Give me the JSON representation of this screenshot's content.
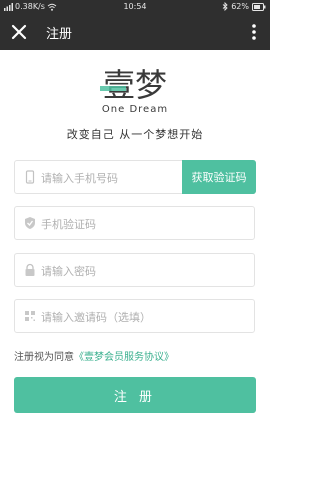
{
  "status_bar": {
    "network": "0.38K/s",
    "time": "10:54",
    "battery": "62%"
  },
  "app_bar": {
    "title": "注册",
    "close_icon": "close-icon",
    "more_icon": "more-vertical-icon"
  },
  "logo": {
    "cn": "壹梦",
    "en": "One Dream"
  },
  "slogan": "改变自己 从一个梦想开始",
  "form": {
    "phone": {
      "placeholder": "请输入手机号码",
      "icon": "phone-icon"
    },
    "get_code_label": "获取验证码",
    "code": {
      "placeholder": "手机验证码",
      "icon": "shield-icon"
    },
    "password": {
      "placeholder": "请输入密码",
      "icon": "lock-icon"
    },
    "invite": {
      "placeholder": "请输入邀请码（选填）",
      "icon": "barcode-icon"
    }
  },
  "agreement": {
    "prefix": "注册视为同意",
    "link": "《壹梦会员服务协议》"
  },
  "register_label": "注 册",
  "colors": {
    "accent": "#4fc0a0",
    "bar": "#2f2f2f",
    "logo_dark": "#3a3a3a"
  }
}
